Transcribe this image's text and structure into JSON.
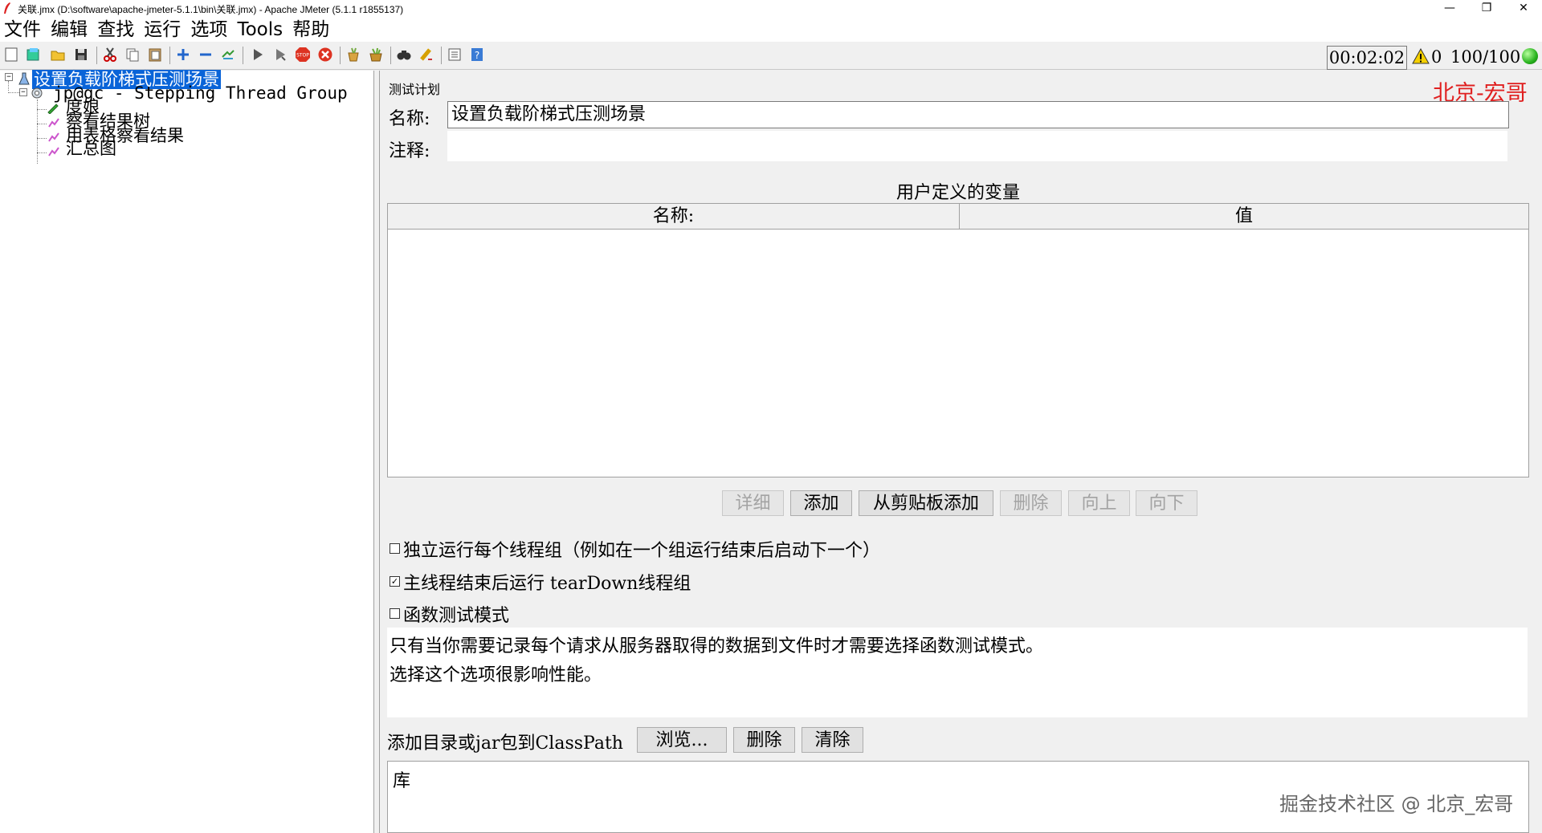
{
  "window": {
    "title": "关联.jmx (D:\\software\\apache-jmeter-5.1.1\\bin\\关联.jmx) - Apache JMeter (5.1.1 r1855137)",
    "minimize": "—",
    "restore": "❐",
    "close": "✕"
  },
  "menu": [
    "文件",
    "编辑",
    "查找",
    "运行",
    "选项",
    "Tools",
    "帮助"
  ],
  "toolbar": {
    "timer": "00:02:02",
    "warning_count": "0",
    "threads": "100/100",
    "status_color": "#27b21d"
  },
  "tree": {
    "root": "设置负载阶梯式压测场景",
    "thread_group": "jp@gc - Stepping Thread Group",
    "children": [
      "度娘",
      "察看结果树",
      "用表格察看结果",
      "汇总图"
    ]
  },
  "panel": {
    "section_title": "测试计划",
    "brand": "北京-宏哥",
    "name_label": "名称:",
    "name_value": "设置负载阶梯式压测场景",
    "comment_label": "注释:",
    "comment_value": "",
    "vars_title": "用户定义的变量",
    "columns": [
      "名称:",
      "值"
    ],
    "buttons": {
      "detail": "详细",
      "add": "添加",
      "add_from_clipboard": "从剪贴板添加",
      "delete": "删除",
      "up": "向上",
      "down": "向下"
    },
    "checkboxes": [
      {
        "label": "独立运行每个线程组（例如在一个组运行结束后启动下一个）",
        "checked": false
      },
      {
        "label": "主线程结束后运行 tearDown线程组",
        "checked": true
      },
      {
        "label": "函数测试模式",
        "checked": false
      }
    ],
    "note_lines": [
      "只有当你需要记录每个请求从服务器取得的数据到文件时才需要选择函数测试模式。",
      "选择这个选项很影响性能。"
    ],
    "classpath_label": "添加目录或jar包到ClassPath",
    "browse": "浏览...",
    "cp_delete": "删除",
    "cp_clear": "清除",
    "lib_header": "库"
  },
  "watermark": "掘金技术社区 @ 北京_宏哥"
}
